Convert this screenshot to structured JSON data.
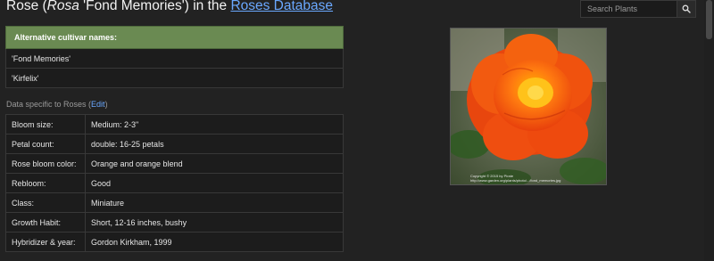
{
  "header": {
    "title_prefix": "Rose (",
    "title_genus": "Rosa",
    "title_cultivar": " 'Fond Memories') in the ",
    "title_link": "Roses Database"
  },
  "search": {
    "placeholder": "Search Plants"
  },
  "alt_names": {
    "heading": "Alternative cultivar names:",
    "items": [
      "'Fond Memories'",
      "'Kirfelix'"
    ]
  },
  "section": {
    "label": "Data specific to Roses (",
    "edit": "Edit",
    "close": ")"
  },
  "details": [
    {
      "key": "Bloom size:",
      "value": "Medium: 2-3\""
    },
    {
      "key": "Petal count:",
      "value": "double: 16-25 petals"
    },
    {
      "key": "Rose bloom color:",
      "value": "Orange and orange blend"
    },
    {
      "key": "Rebloom:",
      "value": "Good"
    },
    {
      "key": "Class:",
      "value": "Miniature"
    },
    {
      "key": "Growth Habit:",
      "value": "Short, 12-16 inches, bushy"
    },
    {
      "key": "Hybridizer & year:",
      "value": "Gordon Kirkham, 1999"
    }
  ],
  "photo": {
    "caption_line1": "Copyright © 2015 by Pirate",
    "caption_line2": "http://www.garden.org/plants/photo/.../fond_memories.jpg",
    "icons": [
      "rose-photo"
    ]
  },
  "colors": {
    "accent": "#6a8a52",
    "link": "#6aa8ff",
    "background": "#222222"
  }
}
